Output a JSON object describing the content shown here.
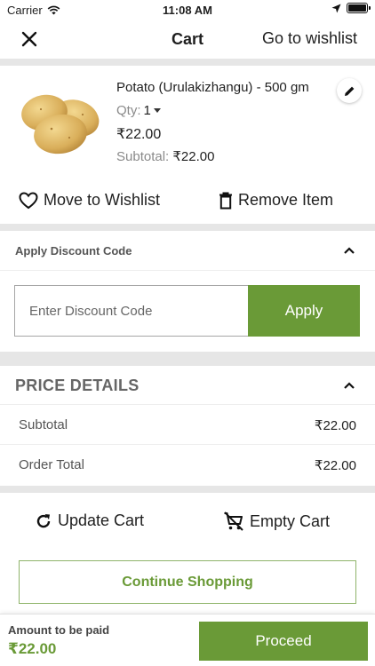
{
  "status_bar": {
    "carrier": "Carrier",
    "time": "11:08 AM"
  },
  "nav": {
    "title": "Cart",
    "wishlist_link": "Go to wishlist"
  },
  "cart_item": {
    "name": "Potato (Urulakizhangu) - 500 gm",
    "qty_label": "Qty:",
    "qty_value": "1",
    "price": "₹22.00",
    "subtotal_label": "Subtotal:",
    "subtotal_value": "₹22.00",
    "move_to_wishlist": "Move to Wishlist",
    "remove_item": "Remove Item"
  },
  "discount": {
    "title": "Apply Discount Code",
    "placeholder": "Enter Discount Code",
    "value": "",
    "apply_label": "Apply"
  },
  "price_details": {
    "title": "PRICE DETAILS",
    "rows": [
      {
        "label": "Subtotal",
        "value": "₹22.00"
      },
      {
        "label": "Order Total",
        "value": "₹22.00"
      }
    ]
  },
  "cart_actions": {
    "update_cart": "Update Cart",
    "empty_cart": "Empty Cart"
  },
  "continue_shopping": "Continue Shopping",
  "footer": {
    "amount_label": "Amount to be paid",
    "amount_value": "₹22.00",
    "proceed_label": "Proceed"
  },
  "colors": {
    "accent_green": "#6a9a37",
    "divider_gray": "#e6e6e6",
    "muted_text": "#8a8a8a"
  },
  "icons": [
    "wifi-icon",
    "location-arrow-icon",
    "battery-icon",
    "close-icon",
    "pencil-icon",
    "heart-icon",
    "trash-icon",
    "chevron-up-icon",
    "refresh-icon",
    "cart-remove-icon"
  ]
}
